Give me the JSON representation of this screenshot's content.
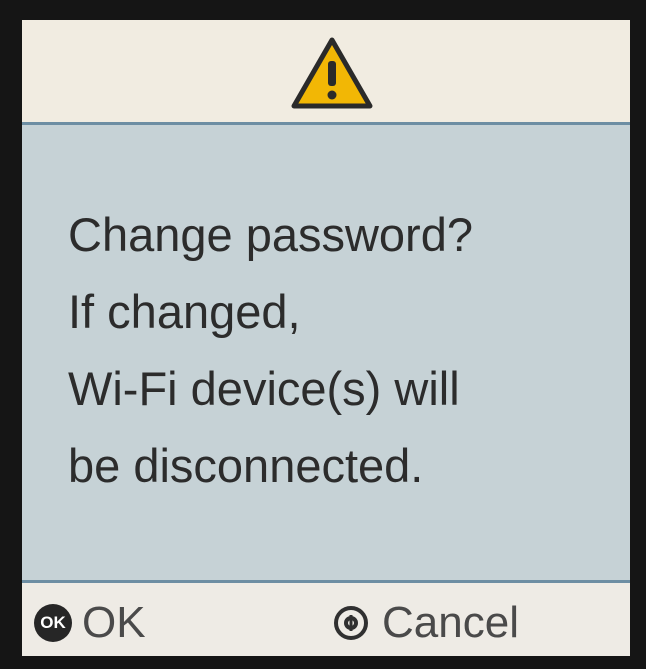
{
  "dialog": {
    "message_lines": [
      "Change password?",
      "If changed,",
      "Wi-Fi device(s) will",
      "be disconnected."
    ]
  },
  "footer": {
    "ok_icon_text": "OK",
    "ok_label": "OK",
    "cancel_label": "Cancel"
  },
  "icons": {
    "title": "warning-icon",
    "ok": "ok-circle-icon",
    "cancel": "cancel-circle-icon"
  },
  "colors": {
    "title_bar": "#f1ece1",
    "message_area": "#c6d2d6",
    "warning_fill": "#f2b705",
    "footer": "#eeebe5",
    "divider": "#6d8ea3"
  }
}
